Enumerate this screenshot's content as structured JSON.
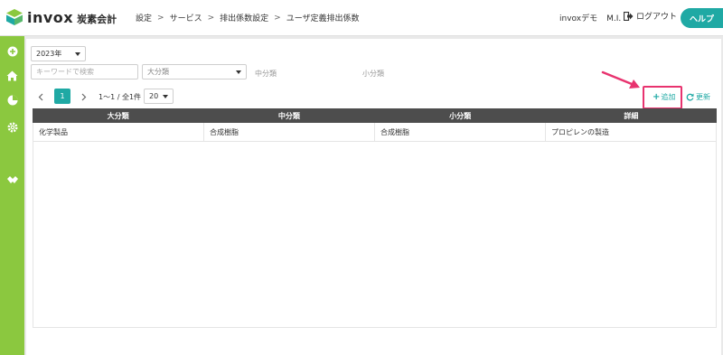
{
  "app": {
    "logo_text": "invox",
    "logo_subtitle": "炭素会計"
  },
  "breadcrumb": [
    "設定",
    "サービス",
    "排出係数設定",
    "ユーザ定義排出係数"
  ],
  "header": {
    "org": "invoxデモ",
    "user": "M.I.",
    "logout_label": "ログアウト",
    "help_label": "ヘルプ"
  },
  "sidebar": {
    "icons": [
      "plus-circle-icon",
      "home-icon",
      "pie-chart-icon",
      "gear-icon",
      "handshake-icon"
    ]
  },
  "filters": {
    "year_value": "2023年",
    "keyword_placeholder": "キーワードで検索",
    "category_large_value": "大分類",
    "category_mid_label": "中分類",
    "category_small_label": "小分類"
  },
  "pagination": {
    "current_page": "1",
    "count_text": "1〜1 / 全1件",
    "per_page": "20"
  },
  "actions": {
    "add_label": "追加",
    "refresh_label": "更新"
  },
  "table": {
    "headers": [
      "大分類",
      "中分類",
      "小分類",
      "詳細"
    ],
    "rows": [
      [
        "化学製品",
        "合成樹脂",
        "合成樹脂",
        "プロピレンの製造"
      ]
    ]
  },
  "colors": {
    "brand_teal": "#1fa9a4",
    "sidebar_green": "#8bc83f",
    "highlight_pink": "#e8336f",
    "table_header": "#4d4d4d"
  }
}
